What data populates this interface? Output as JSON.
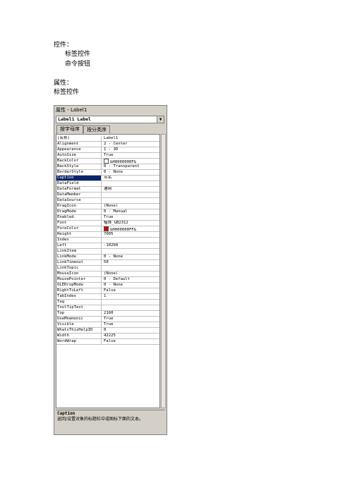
{
  "document": {
    "line1": "控件：",
    "line2": "标签控件",
    "line3": "命令按钮",
    "line4": "属性：",
    "line5": "标签控件"
  },
  "window": {
    "title": "属性 - Label1",
    "object": "Label1 Label",
    "tabs": [
      "按字母序",
      "按分类序"
    ],
    "description_title": "Caption",
    "description_text": "返回/设置对象的标题栏中或图标下面的文本。"
  },
  "properties": [
    {
      "name": "(名称)",
      "value": "Label1"
    },
    {
      "name": "Alignment",
      "value": "2 - Center"
    },
    {
      "name": "Appearance",
      "value": "1 - 3D"
    },
    {
      "name": "AutoSize",
      "value": "True"
    },
    {
      "name": "BackColor",
      "value": "&H8000000F&",
      "swatch": "#ffffff"
    },
    {
      "name": "BackStyle",
      "value": "0 - Transparent"
    },
    {
      "name": "BorderStyle",
      "value": "0 - None"
    },
    {
      "name": "Caption",
      "value": "点名",
      "selected": true
    },
    {
      "name": "DataField",
      "value": ""
    },
    {
      "name": "DataFormat",
      "value": "通用"
    },
    {
      "name": "DataMember",
      "value": ""
    },
    {
      "name": "DataSource",
      "value": ""
    },
    {
      "name": "DragIcon",
      "value": "(None)"
    },
    {
      "name": "DragMode",
      "value": "0 - Manual"
    },
    {
      "name": "Enabled",
      "value": "True"
    },
    {
      "name": "Font",
      "value": "楷体_GB2312"
    },
    {
      "name": "ForeColor",
      "value": "&H000000FF&",
      "swatch": "#d40000"
    },
    {
      "name": "Height",
      "value": "7005"
    },
    {
      "name": "Index",
      "value": ""
    },
    {
      "name": "Left",
      "value": "-10260"
    },
    {
      "name": "LinkItem",
      "value": ""
    },
    {
      "name": "LinkMode",
      "value": "0 - None"
    },
    {
      "name": "LinkTimeout",
      "value": "50"
    },
    {
      "name": "LinkTopic",
      "value": ""
    },
    {
      "name": "MouseIcon",
      "value": "(None)"
    },
    {
      "name": "MousePointer",
      "value": "0 - Default"
    },
    {
      "name": "OLEDropMode",
      "value": "0 - None"
    },
    {
      "name": "RightToLeft",
      "value": "False"
    },
    {
      "name": "TabIndex",
      "value": "1"
    },
    {
      "name": "Tag",
      "value": ""
    },
    {
      "name": "ToolTipText",
      "value": ""
    },
    {
      "name": "Top",
      "value": "2160"
    },
    {
      "name": "UseMnemonic",
      "value": "True"
    },
    {
      "name": "Visible",
      "value": "True"
    },
    {
      "name": "WhatsThisHelpID",
      "value": "0"
    },
    {
      "name": "Width",
      "value": "42225"
    },
    {
      "name": "WordWrap",
      "value": "False"
    }
  ]
}
